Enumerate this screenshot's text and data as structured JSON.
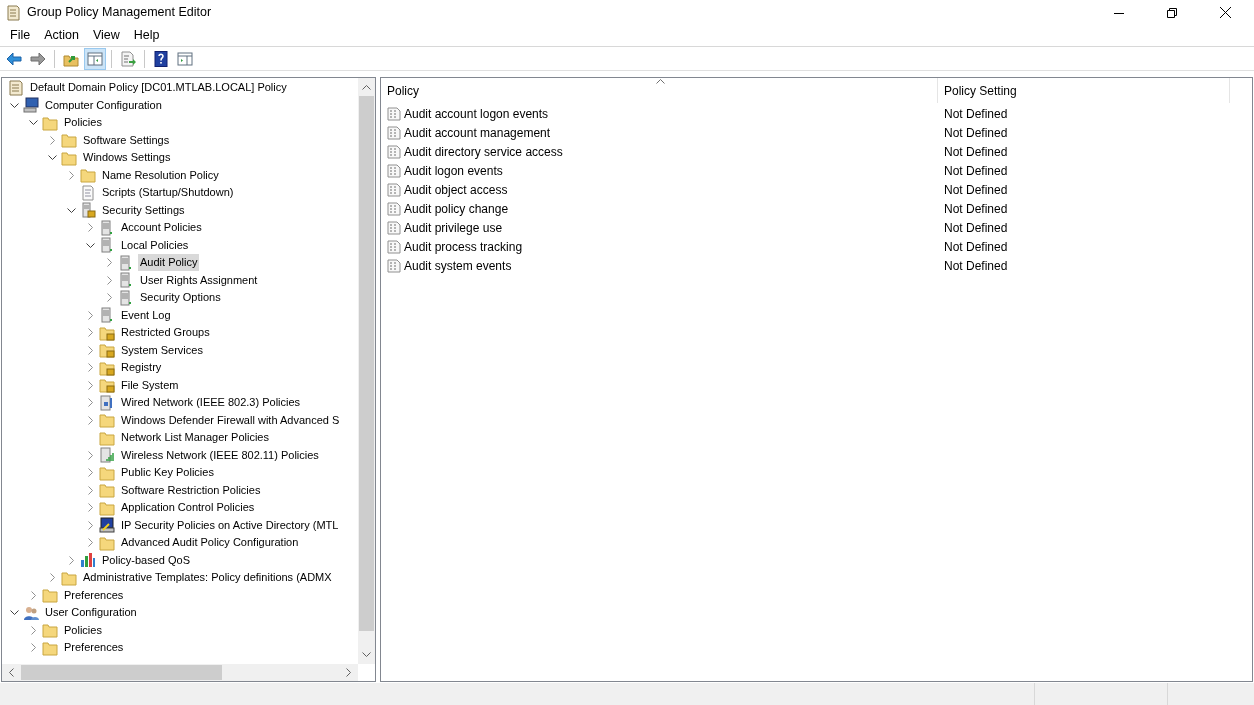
{
  "window": {
    "title": "Group Policy Management Editor"
  },
  "menu": [
    "File",
    "Action",
    "View",
    "Help"
  ],
  "toolbar": [
    [
      {
        "kind": "back",
        "selected": false
      },
      {
        "kind": "forward",
        "selected": false
      }
    ],
    [
      {
        "kind": "up",
        "selected": false
      },
      {
        "kind": "pane",
        "selected": true
      }
    ],
    [
      {
        "kind": "export",
        "selected": false
      }
    ],
    [
      {
        "kind": "help",
        "selected": false
      },
      {
        "kind": "action-pane",
        "selected": false
      }
    ]
  ],
  "tree": [
    {
      "label": "Default Domain Policy [DC01.MTLAB.LOCAL] Policy",
      "kind": "doc",
      "selected": false,
      "children": [
        {
          "label": "Computer Configuration",
          "kind": "computer",
          "expanded": true,
          "selected": false,
          "children": [
            {
              "label": "Policies",
              "kind": "folder",
              "expanded": true,
              "selected": false,
              "children": [
                {
                  "label": "Software Settings",
                  "kind": "folder",
                  "expanded": false,
                  "selected": false
                },
                {
                  "label": "Windows Settings",
                  "kind": "folder",
                  "expanded": true,
                  "selected": false,
                  "children": [
                    {
                      "label": "Name Resolution Policy",
                      "kind": "folder",
                      "expanded": false,
                      "selected": false
                    },
                    {
                      "label": "Scripts (Startup/Shutdown)",
                      "kind": "script",
                      "selected": false
                    },
                    {
                      "label": "Security Settings",
                      "kind": "secure",
                      "expanded": true,
                      "selected": false,
                      "children": [
                        {
                          "label": "Account Policies",
                          "kind": "server",
                          "expanded": false,
                          "selected": false
                        },
                        {
                          "label": "Local Policies",
                          "kind": "server",
                          "expanded": true,
                          "selected": false,
                          "children": [
                            {
                              "label": "Audit Policy",
                              "kind": "server",
                              "expanded": false,
                              "selected": true
                            },
                            {
                              "label": "User Rights Assignment",
                              "kind": "server",
                              "expanded": false,
                              "selected": false
                            },
                            {
                              "label": "Security Options",
                              "kind": "server",
                              "expanded": false,
                              "selected": false
                            }
                          ]
                        },
                        {
                          "label": "Event Log",
                          "kind": "server",
                          "expanded": false,
                          "selected": false
                        },
                        {
                          "label": "Restricted Groups",
                          "kind": "lockfolder",
                          "expanded": false,
                          "selected": false
                        },
                        {
                          "label": "System Services",
                          "kind": "lockfolder",
                          "expanded": false,
                          "selected": false
                        },
                        {
                          "label": "Registry",
                          "kind": "lockfolder",
                          "expanded": false,
                          "selected": false
                        },
                        {
                          "label": "File System",
                          "kind": "lockfolder",
                          "expanded": false,
                          "selected": false
                        },
                        {
                          "label": "Wired Network (IEEE 802.3) Policies",
                          "kind": "wired",
                          "expanded": false,
                          "selected": false
                        },
                        {
                          "label": "Windows Defender Firewall with Advanced S",
                          "kind": "folder",
                          "expanded": false,
                          "selected": false
                        },
                        {
                          "label": "Network List Manager Policies",
                          "kind": "folder",
                          "selected": false
                        },
                        {
                          "label": "Wireless Network (IEEE 802.11) Policies",
                          "kind": "wireless",
                          "expanded": false,
                          "selected": false
                        },
                        {
                          "label": "Public Key Policies",
                          "kind": "folder",
                          "expanded": false,
                          "selected": false
                        },
                        {
                          "label": "Software Restriction Policies",
                          "kind": "folder",
                          "expanded": false,
                          "selected": false
                        },
                        {
                          "label": "Application Control Policies",
                          "kind": "folder",
                          "expanded": false,
                          "selected": false
                        },
                        {
                          "label": "IP Security Policies on Active Directory (MTL",
                          "kind": "ipsec",
                          "expanded": false,
                          "selected": false
                        },
                        {
                          "label": "Advanced Audit Policy Configuration",
                          "kind": "folder",
                          "expanded": false,
                          "selected": false
                        }
                      ]
                    },
                    {
                      "label": "Policy-based QoS",
                      "kind": "qos",
                      "expanded": false,
                      "selected": false
                    }
                  ]
                },
                {
                  "label": "Administrative Templates: Policy definitions (ADMX",
                  "kind": "folder",
                  "expanded": false,
                  "selected": false
                }
              ]
            },
            {
              "label": "Preferences",
              "kind": "folder",
              "expanded": false,
              "selected": false
            }
          ]
        },
        {
          "label": "User Configuration",
          "kind": "user",
          "expanded": true,
          "selected": false,
          "children": [
            {
              "label": "Policies",
              "kind": "folder",
              "expanded": false,
              "selected": false
            },
            {
              "label": "Preferences",
              "kind": "folder",
              "expanded": false,
              "selected": false
            }
          ]
        }
      ]
    }
  ],
  "table": {
    "columns": [
      "Policy",
      "Policy Setting"
    ],
    "rows": [
      {
        "policy": "Audit account logon events",
        "setting": "Not Defined"
      },
      {
        "policy": "Audit account management",
        "setting": "Not Defined"
      },
      {
        "policy": "Audit directory service access",
        "setting": "Not Defined"
      },
      {
        "policy": "Audit logon events",
        "setting": "Not Defined"
      },
      {
        "policy": "Audit object access",
        "setting": "Not Defined"
      },
      {
        "policy": "Audit policy change",
        "setting": "Not Defined"
      },
      {
        "policy": "Audit privilege use",
        "setting": "Not Defined"
      },
      {
        "policy": "Audit process tracking",
        "setting": "Not Defined"
      },
      {
        "policy": "Audit system events",
        "setting": "Not Defined"
      }
    ]
  }
}
